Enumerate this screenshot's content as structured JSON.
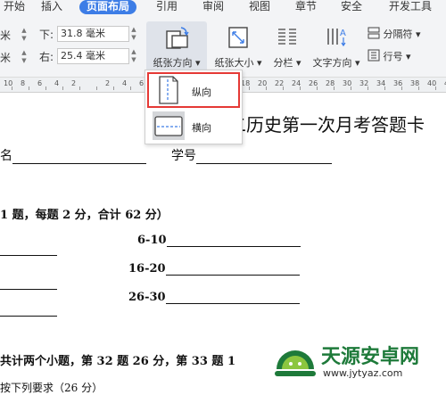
{
  "tabs": [
    {
      "label": "开始",
      "active": false
    },
    {
      "label": "插入",
      "active": false
    },
    {
      "label": "页面布局",
      "active": true
    },
    {
      "label": "引用",
      "active": false
    },
    {
      "label": "审阅",
      "active": false
    },
    {
      "label": "视图",
      "active": false
    },
    {
      "label": "章节",
      "active": false
    },
    {
      "label": "安全",
      "active": false
    },
    {
      "label": "开发工具",
      "active": false
    }
  ],
  "margins": {
    "top_partial": "米",
    "left_partial": "米",
    "bottom_label": "下:",
    "bottom_value": "31.8 毫米",
    "right_label": "右:",
    "right_value": "25.4 毫米"
  },
  "ribbon": {
    "orientation_label": "纸张方向",
    "size_label": "纸张大小",
    "columns_label": "分栏",
    "text_direction_label": "文字方向",
    "separator_label": "分隔符",
    "line_numbers_label": "行号"
  },
  "ruler": {
    "ticks": [
      "10",
      "8",
      "6",
      "4",
      "2",
      "",
      "2",
      "4",
      "6",
      "8",
      "10",
      "12",
      "14",
      "16",
      "18",
      "20",
      "22",
      "24",
      "26",
      "28",
      "30",
      "32",
      "34",
      "36",
      "38",
      "40",
      "42"
    ]
  },
  "orientation_menu": {
    "portrait": "纵向",
    "landscape": "横向"
  },
  "document": {
    "title": "二历史第一次月考答题卡",
    "name_partial": "名",
    "student_id": "学号",
    "section1": "1 题，每题 2 分，合计 62 分）",
    "q6": "6-10",
    "q16": "16-20",
    "q26": "26-30",
    "section2": "共计两个小题，第 32 题 26 分，第 33 题 1",
    "requirement": "按下列要求（26 分）"
  },
  "watermark": {
    "name": "天源安卓网",
    "url": "www.jytyaz.com"
  },
  "colors": {
    "active_tab": "#3d7de6",
    "highlight_border": "#e53935",
    "watermark_green": "#1e7a3a"
  }
}
